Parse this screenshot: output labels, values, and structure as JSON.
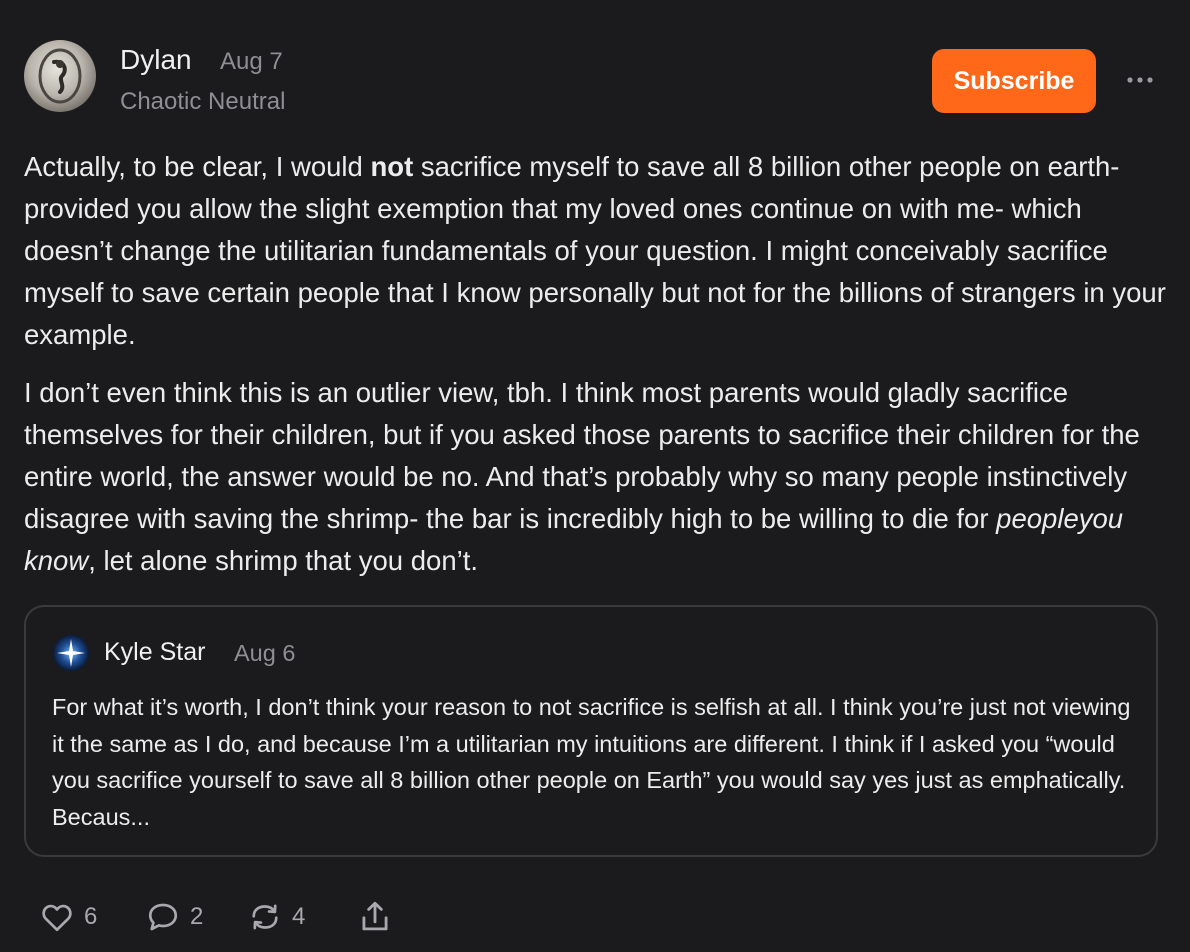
{
  "post": {
    "author": "Dylan",
    "date": "Aug 7",
    "subtitle": "Chaotic Neutral",
    "subscribe_label": "Subscribe",
    "p1_a": "Actually, to be clear, I would ",
    "p1_bold": "not",
    "p1_b": " sacrifice myself to save all 8 billion other people on earth- provided you allow the slight exemption that my loved ones continue on with me- which doesn’t change the utilitarian fundamentals of your question. I might conceivably sacrifice myself to save certain people that I know personally but not for the billions of strangers in your example.",
    "p2_a": "I don’t even think this is an outlier view, tbh. I think most parents would gladly sacrifice themselves for their children, but if you asked those parents to sacrifice their children for the entire world, the answer would be no. And that’s probably why so many people instinctively disagree with saving the shrimp- the bar is incredibly high to be willing to die for ",
    "p2_italic": "peopleyou know",
    "p2_b": ", let alone shrimp that you don’t."
  },
  "quote": {
    "author": "Kyle Star",
    "date": "Aug 6",
    "text": "For what it’s worth, I don’t think your reason to not sacrifice is selfish at all. I think you’re just not viewing it the same as I do, and because I’m a utilitarian my intuitions are different. I think if I asked you “would you sacrifice yourself to save all 8 billion other people on Earth” you would say yes just as emphatically. Becaus..."
  },
  "actions": {
    "likes": "6",
    "comments": "2",
    "restacks": "4"
  },
  "colors": {
    "background": "#1b1b1d",
    "accent": "#ff6719",
    "muted": "#8e8e93",
    "border": "#3a3a3d"
  },
  "icons": [
    "avatar-image",
    "more-icon",
    "star-icon",
    "heart-icon",
    "comment-icon",
    "restack-icon",
    "share-icon"
  ]
}
